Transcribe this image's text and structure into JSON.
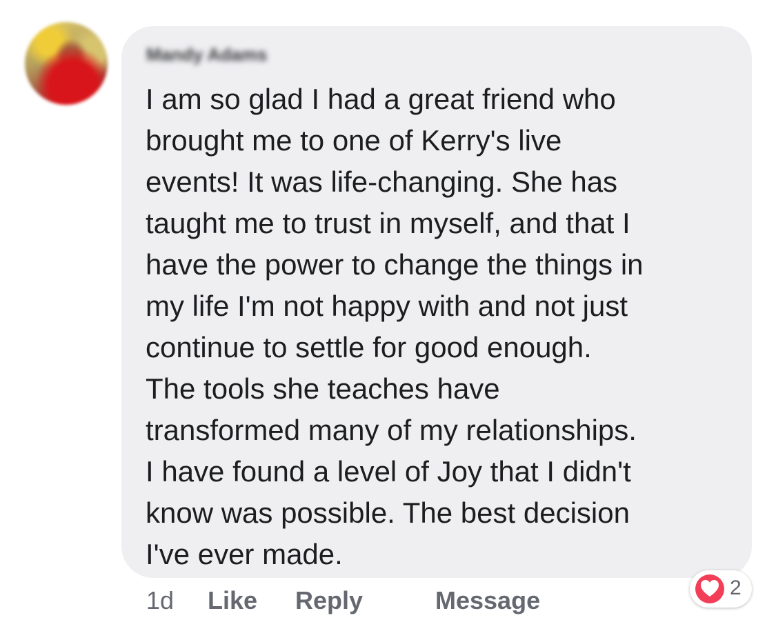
{
  "comment": {
    "author_name": "Mandy Adams",
    "text": "I am so glad I had a great friend who\nbrought me to one of Kerry's live\nevents! It was life-changing. She has\ntaught me to trust in myself, and that I\nhave the power to change the things in\nmy life I'm not happy with and not just\ncontinue to settle for good enough.\nThe tools she teaches have\ntransformed many of my relationships.\nI have found a level of Joy that I didn't\nknow was possible. The best decision\nI've ever made.",
    "timestamp": "1d",
    "actions": {
      "like": "Like",
      "reply": "Reply",
      "message": "Message"
    },
    "reaction": {
      "icon": "heart-icon",
      "count": "2"
    }
  },
  "colors": {
    "bubble": "#efeff2",
    "text": "#1c1d1f",
    "secondary_text": "#656870",
    "heart": "#f33e58"
  }
}
